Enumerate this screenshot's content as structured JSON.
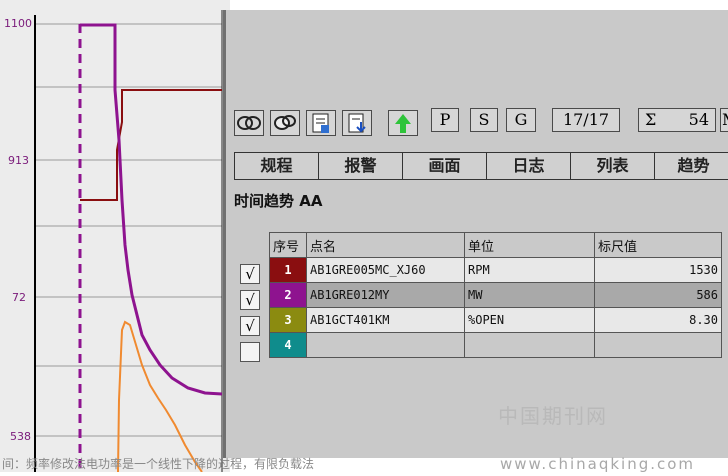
{
  "trend": {
    "y_ticks": [
      "1100",
      "913",
      "72",
      "538"
    ]
  },
  "toolbar": {
    "icons": [
      "handshake-icon",
      "handshake-alt-icon",
      "report-icon",
      "download-icon",
      "up-arrow-icon"
    ],
    "p_label": "P",
    "s_label": "S",
    "g_label": "G",
    "page_counter": "17/17",
    "sum_symbol": "Σ",
    "sum_value": "54",
    "more_label": "M"
  },
  "tabs": [
    "规程",
    "报警",
    "画面",
    "日志",
    "列表",
    "趋势"
  ],
  "section_title": "时间趋势 AA",
  "table": {
    "headers": [
      "序号",
      "点名",
      "单位",
      "标尺值"
    ],
    "rows": [
      {
        "index": "1",
        "name": "AB1GRE005MC_XJ60",
        "unit": "RPM",
        "scale": "1530",
        "color": "#8a0e10",
        "checked": "√"
      },
      {
        "index": "2",
        "name": "AB1GRE012MY",
        "unit": "MW",
        "scale": "586",
        "color": "#8e138f",
        "checked": "√"
      },
      {
        "index": "3",
        "name": "AB1GCT401KM",
        "unit": "%OPEN",
        "scale": "8.30",
        "color": "#8b8b10",
        "checked": "√"
      },
      {
        "index": "4",
        "name": "",
        "unit": "",
        "scale": "",
        "color": "#0f8c8c",
        "checked": ""
      }
    ]
  },
  "watermark": "中国期刊网",
  "caption": {
    "text": "间：频率修改法电功率是一个线性下降的过程，有限负载法",
    "url": "www.chinaqking.com"
  }
}
